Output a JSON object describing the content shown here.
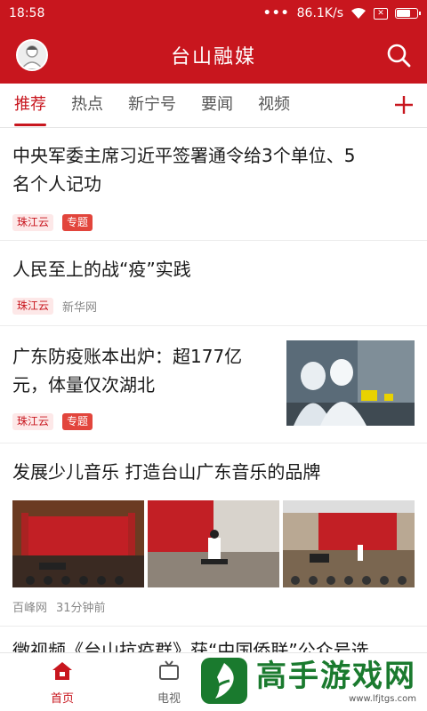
{
  "status_bar": {
    "time": "18:58",
    "dots": "•••",
    "network_speed": "86.1K/s",
    "sim_icon": "✕",
    "battery_level": 0.7
  },
  "header": {
    "title": "台山融媒"
  },
  "tabs": [
    {
      "label": "推荐",
      "active": true
    },
    {
      "label": "热点",
      "active": false
    },
    {
      "label": "新宁号",
      "active": false
    },
    {
      "label": "要闻",
      "active": false
    },
    {
      "label": "视频",
      "active": false
    }
  ],
  "articles": [
    {
      "line1": "中央军委主席习近平签署通令给3个单位、5",
      "line2": "名个人记功",
      "source": "珠江云",
      "tag": "专题"
    },
    {
      "line1": "人民至上的战“疫”实践",
      "source": "珠江云",
      "publisher": "新华网"
    },
    {
      "line1": "广东防疫账本出炉：超177亿",
      "line2": "元，体量仅次湖北",
      "source": "珠江云",
      "tag": "专题"
    },
    {
      "line1": "发展少儿音乐 打造台山广东音乐的品牌",
      "publisher": "百峰网",
      "time": "31分钟前"
    },
    {
      "line1": "微视频《台山抗疫群》获“中国侨联”公众号选"
    }
  ],
  "bottom_nav": [
    {
      "label": "首页",
      "active": true
    },
    {
      "label": "电视",
      "active": false
    }
  ],
  "watermark": {
    "title": "高手游戏网",
    "url": "www.lfjtgs.com"
  },
  "colors": {
    "brand_red": "#c8161e",
    "tag_red": "#e2453c",
    "watermark_green": "#1a7a2e"
  },
  "icons": [
    "user-avatar-icon",
    "search-icon",
    "plus-icon",
    "home-icon",
    "tv-icon",
    "wifi-icon",
    "battery-icon"
  ]
}
